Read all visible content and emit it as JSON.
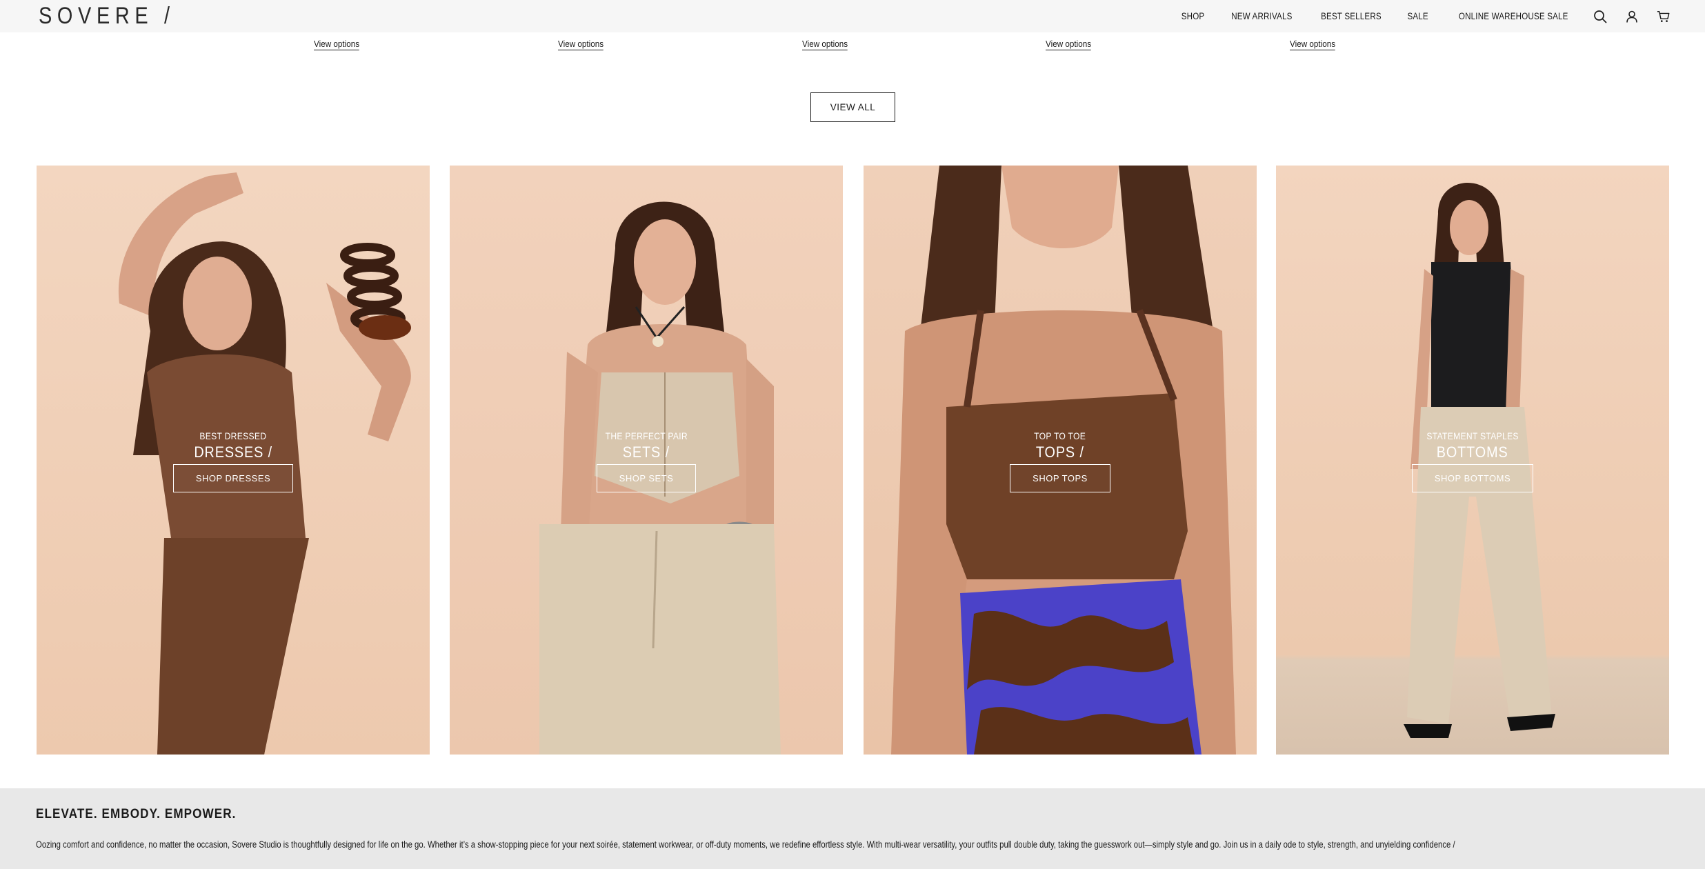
{
  "header": {
    "logo": "SOVERE /",
    "nav": [
      "SHOP",
      "NEW ARRIVALS",
      "BEST SELLERS",
      "SALE",
      "ONLINE WAREHOUSE SALE"
    ],
    "icons": [
      "search-icon",
      "account-icon",
      "cart-icon"
    ]
  },
  "products": {
    "option_links": [
      "View options",
      "View options",
      "View options",
      "View options",
      "View options"
    ],
    "view_all": "VIEW ALL"
  },
  "categories": [
    {
      "eyebrow": "BEST DRESSED",
      "title": "DRESSES /",
      "button": "SHOP DRESSES"
    },
    {
      "eyebrow": "THE PERFECT PAIR",
      "title": "SETS /",
      "button": "SHOP SETS"
    },
    {
      "eyebrow": "TOP TO TOE",
      "title": "TOPS /",
      "button": "SHOP TOPS"
    },
    {
      "eyebrow": "STATEMENT STAPLES",
      "title": "BOTTOMS",
      "button": "SHOP BOTTOMS"
    }
  ],
  "about": {
    "heading": "ELEVATE. EMBODY. EMPOWER.",
    "text": "Oozing comfort and confidence, no matter the occasion, Sovere Studio is thoughtfully designed for life on the go. Whether it’s a show-stopping piece for your next soirée, statement workwear, or off-duty moments, we redefine effortless style. With multi-wear versatility, your outfits pull double duty, taking the guesswork out—simply style and go. Join us in a daily ode to style, strength, and unyielding confidence /"
  },
  "colors": {
    "header_bg": "#f6f6f6",
    "tile_bg": "#f2d3bd",
    "about_bg": "#e8e8e8",
    "text": "#1a1a1a"
  }
}
